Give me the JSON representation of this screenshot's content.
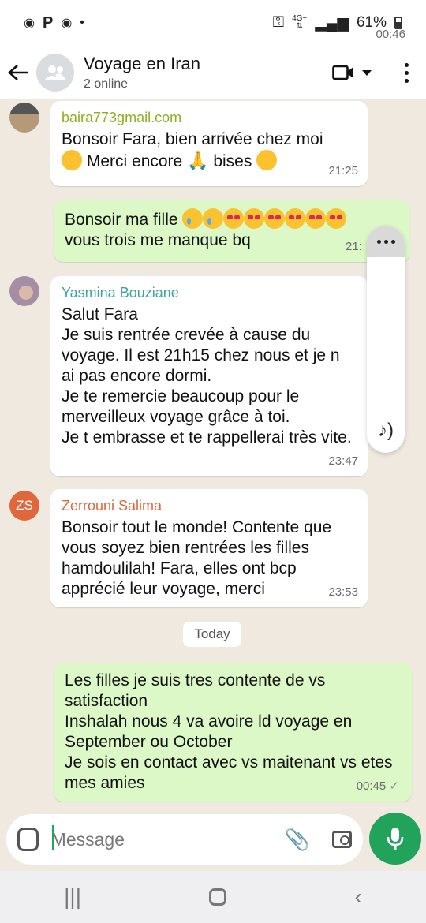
{
  "status": {
    "time": "00:46",
    "network_label": "4G+",
    "battery": "61%"
  },
  "header": {
    "title": "Voyage en Iran",
    "subtitle": "2 online",
    "icons": [
      "back-arrow-icon",
      "group-avatar-icon",
      "video-call-icon",
      "chevron-down-icon",
      "more-options-icon"
    ]
  },
  "messages": [
    {
      "sender": "baira773gmail.com",
      "sender_color": "#8cb022",
      "text_1": "Bonsoir Fara, bien arrivée chez moi",
      "text_2a": "Merci encore",
      "text_2b": "bises",
      "time": "21:25"
    },
    {
      "text_1": "Bonsoir ma fille",
      "text_2": "vous trois me manque bq",
      "time": "21:"
    },
    {
      "sender": "Yasmina Bouziane",
      "sender_color": "#3aa59a",
      "text": "Salut Fara\nJe suis rentrée crevée à cause du voyage. Il est 21h15 chez nous et je n ai pas encore dormi.\nJe te remercie beaucoup pour le merveilleux voyage grâce à toi.\nJe t embrasse et te rappellerai très vite.",
      "time": "23:47"
    },
    {
      "sender": "Zerrouni Salima",
      "sender_color": "#e0663b",
      "initials": "ZS",
      "text": "Bonsoir tout le monde! Contente que vous soyez bien rentrées les filles hamdoulilah! Fara, elles ont bcp apprécié leur voyage, merci",
      "time": "23:53"
    },
    {
      "text": "Les filles je suis tres contente de vs satisfaction\nInshalah nous 4 va avoire ld voyage en September ou October\nJe sois en contact avec vs maitenant vs etes mes amies",
      "time": "00:45",
      "check": "✓"
    }
  ],
  "date_chip": "Today",
  "composer": {
    "placeholder": "Message"
  },
  "colors": {
    "outgoing_bubble": "#dcf8c6",
    "incoming_bubble": "#ffffff",
    "mic_button": "#21a35b",
    "chat_bg": "#efe9e0"
  }
}
